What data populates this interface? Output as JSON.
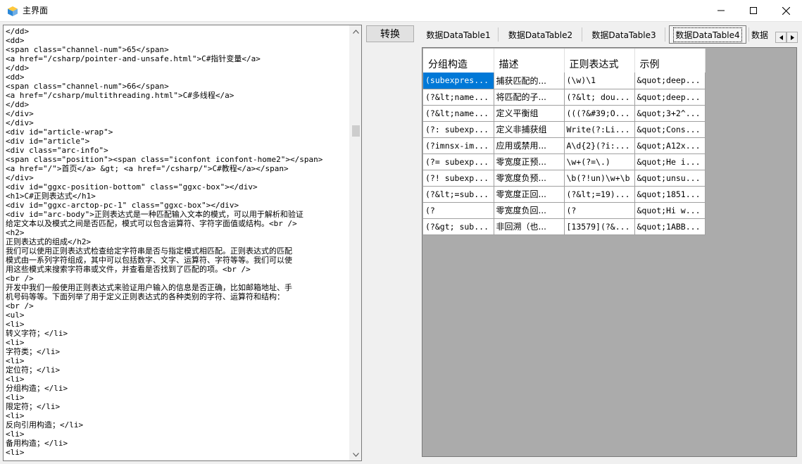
{
  "window": {
    "title": "主界面"
  },
  "editor": {
    "lines": [
      "</dd>",
      "<dd>",
      "<span class=\"channel-num\">65</span>",
      "<a href=\"/csharp/pointer-and-unsafe.html\">C#指针变量</a>",
      "</dd>",
      "<dd>",
      "<span class=\"channel-num\">66</span>",
      "<a href=\"/csharp/multithreading.html\">C#多线程</a>",
      "</dd>",
      "</div>",
      "</div>",
      "<div id=\"article-wrap\">",
      "<div id=\"article\">",
      "<div class=\"arc-info\">",
      "<span class=\"position\"><span class=\"iconfont iconfont-home2\"></span>",
      "<a href=\"/\">首页</a> &gt; <a href=\"/csharp/\">C#教程</a></span>",
      "</div>",
      "<div id=\"ggxc-position-bottom\" class=\"ggxc-box\"></div>",
      "<h1>C#正则表达式</h1>",
      "<div id=\"ggxc-arctop-pc-1\" class=\"ggxc-box\"></div>",
      "<div id=\"arc-body\">正则表达式是一种匹配输入文本的模式，可以用于解析和验证",
      "给定文本以及模式之间是否匹配，模式可以包含运算符、字符字面值或结构。<br />",
      "<h2>",
      "正则表达式的组成</h2>",
      "我们可以使用正则表达式检查给定字符串是否与指定模式相匹配。正则表达式的匹配",
      "模式由一系列字符组成，其中可以包括数字、文字、运算符、字符等等。我们可以使",
      "用这些模式来搜索字符串或文件，并查看是否找到了匹配的项。<br />",
      "<br />",
      "开发中我们一般使用正则表达式来验证用户输入的信息是否正确，比如邮箱地址、手",
      "机号码等等。下面列举了用于定义正则表达式的各种类别的字符、运算符和结构：",
      "<br />",
      "<ul>",
      "<li>",
      "转义字符；</li>",
      "<li>",
      "字符类；</li>",
      "<li>",
      "定位符；</li>",
      "<li>",
      "分组构造；</li>",
      "<li>",
      "限定符；</li>",
      "<li>",
      "反向引用构造；</li>",
      "<li>",
      "备用构造；</li>",
      "<li>"
    ]
  },
  "toolbar": {
    "convert_label": "转换"
  },
  "tabs": [
    {
      "label": "数据DataTable1"
    },
    {
      "label": "数据DataTable2"
    },
    {
      "label": "数据DataTable3"
    },
    {
      "label": "数据DataTable4"
    },
    {
      "label": "数据"
    }
  ],
  "grid": {
    "columns": [
      "分组构造",
      "描述",
      "正则表达式",
      "示例"
    ],
    "rows": [
      [
        "(subexpres...",
        "捕获匹配的...",
        "(\\w)\\1",
        "&quot;deep..."
      ],
      [
        "(?&lt;name...",
        "将匹配的子...",
        "(?&lt; dou...",
        "&quot;deep..."
      ],
      [
        "(?&lt;name...",
        "定义平衡组",
        "(((?&#39;O...",
        "&quot;3+2^..."
      ],
      [
        "(?: subexp...",
        "定义非捕获组",
        "Write(?:Li...",
        "&quot;Cons..."
      ],
      [
        "(?imnsx-im...",
        "应用或禁用...",
        "A\\d{2}(?i:...",
        "&quot;A12x..."
      ],
      [
        "(?= subexp...",
        "零宽度正预...",
        "\\w+(?=\\.)",
        "&quot;He i..."
      ],
      [
        "(?! subexp...",
        "零宽度负预...",
        "\\b(?!un)\\w+\\b",
        "&quot;unsu..."
      ],
      [
        "(?&lt;=sub...",
        "零宽度正回...",
        "(?&lt;=19)...",
        "&quot;1851..."
      ],
      [
        "(?",
        "零宽度负回...",
        "(?",
        "&quot;Hi w..."
      ],
      [
        "(?&gt; sub...",
        "非回溯（也...",
        "[13579](?&...",
        "&quot;1ABB..."
      ]
    ]
  },
  "colors": {
    "selection": "#0078d7",
    "grid_background": "#ababab"
  }
}
